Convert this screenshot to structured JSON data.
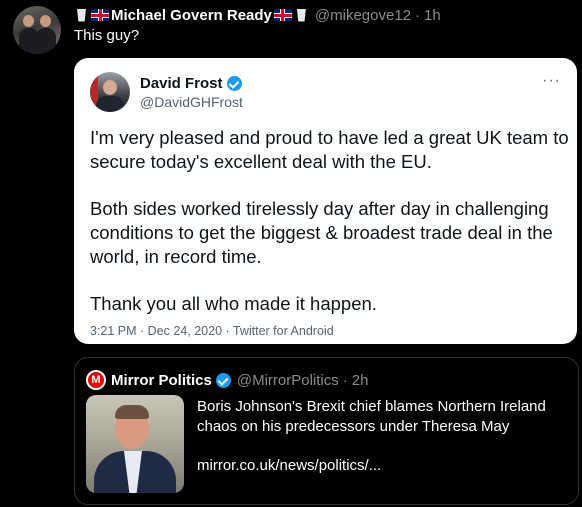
{
  "tweet": {
    "display_name": "Michael Govern Ready",
    "handle": "@mikegove12",
    "time": "1h",
    "text": "This guy?"
  },
  "quoted_tweet": {
    "display_name": "David Frost",
    "handle": "@DavidGHFrost",
    "more": "···",
    "paragraphs": [
      "I'm very pleased and proud to have led a great UK team to secure today's excellent deal with the EU.",
      "Both sides worked tirelessly day after day in challenging conditions to get the biggest & broadest trade deal in the world, in record time.",
      "Thank you all who made it happen."
    ],
    "meta": "3:21 PM · Dec 24, 2020 · Twitter for Android"
  },
  "media_card": {
    "logo_letter": "M",
    "display_name": "Mirror Politics",
    "handle": "@MirrorPolitics",
    "time": "2h",
    "headline": "Boris Johnson's Brexit chief blames Northern Ireland chaos on his predecessors under Theresa May",
    "link": "mirror.co.uk/news/politics/..."
  },
  "colors": {
    "background": "#000000",
    "verified": "#1d9bf0",
    "secondary_text": "#8b8b8b"
  },
  "icons": [
    "cup-icon",
    "uk-flag-icon",
    "verified-badge-icon",
    "mirror-logo-icon",
    "more-options-icon"
  ]
}
